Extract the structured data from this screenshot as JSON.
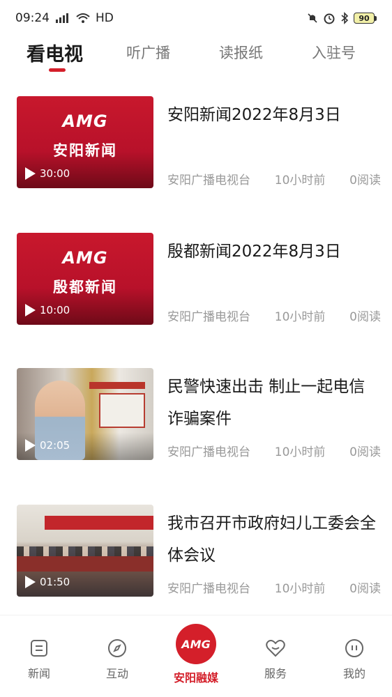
{
  "status_bar": {
    "time": "09:24",
    "network": "HD",
    "battery": "90"
  },
  "tabs": [
    {
      "label": "看电视",
      "active": true
    },
    {
      "label": "听广播",
      "active": false
    },
    {
      "label": "读报纸",
      "active": false
    },
    {
      "label": "入驻号",
      "active": false
    }
  ],
  "news": [
    {
      "title": "安阳新闻2022年8月3日",
      "source": "安阳广播电视台",
      "time": "10小时前",
      "reads": "0阅读",
      "duration": "30:00",
      "thumb_logo": "AMG",
      "thumb_caption": "安阳新闻"
    },
    {
      "title": " 殷都新闻2022年8月3日",
      "source": "安阳广播电视台",
      "time": "10小时前",
      "reads": "0阅读",
      "duration": "10:00",
      "thumb_logo": "AMG",
      "thumb_caption": "殷都新闻"
    },
    {
      "title": "民警快速出击 制止一起电信诈骗案件",
      "source": "安阳广播电视台",
      "time": "10小时前",
      "reads": "0阅读",
      "duration": "02:05"
    },
    {
      "title": "我市召开市政府妇儿工委会全体会议",
      "source": "安阳广播电视台",
      "time": "10小时前",
      "reads": "0阅读",
      "duration": "01:50"
    }
  ],
  "bottom_nav": {
    "items": [
      {
        "label": "新闻",
        "icon": "news-icon"
      },
      {
        "label": "互动",
        "icon": "compass-icon"
      },
      {
        "label": "安阳融媒",
        "icon": "amg-logo",
        "logo_text": "AMG",
        "active": true
      },
      {
        "label": "服务",
        "icon": "heart-icon"
      },
      {
        "label": "我的",
        "icon": "profile-icon"
      }
    ]
  },
  "colors": {
    "accent": "#d41f2a",
    "text_primary": "#1a1a1a",
    "text_secondary": "#999999"
  }
}
